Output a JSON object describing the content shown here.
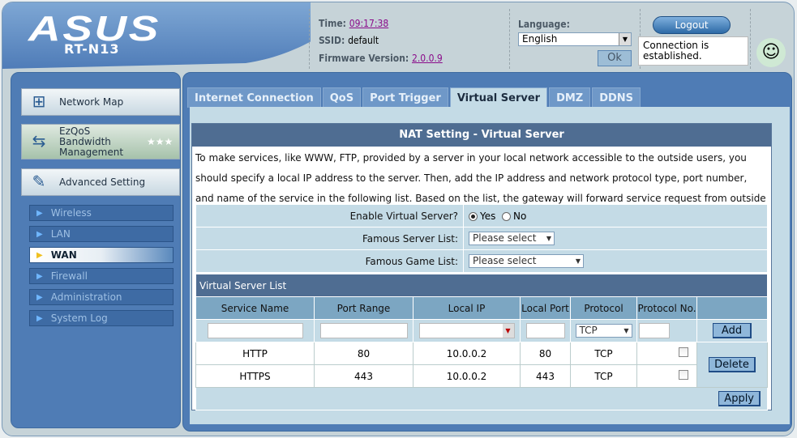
{
  "header": {
    "brand": "ASUS",
    "model": "RT-N13",
    "time_label": "Time:",
    "time": "09:17:38",
    "ssid_label": "SSID:",
    "ssid": "default",
    "firmware_label": "Firmware Version:",
    "firmware": "2.0.0.9",
    "language_label": "Language:",
    "language": "English",
    "ok": "Ok",
    "logout": "Logout",
    "status_tip": "Connection is established."
  },
  "sidebar": {
    "items": [
      {
        "label": "Network Map",
        "icon": "network-icon"
      },
      {
        "label": "EzQoS Bandwidth Management",
        "icon": "bandwidth-icon"
      },
      {
        "label": "Advanced Setting",
        "icon": "wrench-icon"
      }
    ],
    "sub": [
      {
        "label": "Wireless"
      },
      {
        "label": "LAN"
      },
      {
        "label": "WAN",
        "active": true
      },
      {
        "label": "Firewall"
      },
      {
        "label": "Administration"
      },
      {
        "label": "System Log"
      }
    ]
  },
  "tabs": [
    "Internet Connection",
    "QoS",
    "Port Trigger",
    "Virtual Server",
    "DMZ",
    "DDNS"
  ],
  "active_tab": "Virtual Server",
  "page": {
    "title": "NAT Setting - Virtual Server",
    "description": "To make services, like WWW, FTP, provided by a server in your local network accessible to the outside users, you should specify a local IP address to the server. Then, add the IP address and network protocol type, port number, and name of the service in the following list. Based on the list, the gateway will forward service request from outside users to the corresponding local server.",
    "enable_label": "Enable Virtual Server?",
    "yes": "Yes",
    "no": "No",
    "enabled": true,
    "famous_server_label": "Famous Server List:",
    "famous_server_value": "Please select",
    "famous_game_label": "Famous Game List:",
    "famous_game_value": "Please select",
    "list_title": "Virtual Server List",
    "columns": [
      "Service Name",
      "Port Range",
      "Local IP",
      "Local Port",
      "Protocol",
      "Protocol No."
    ],
    "new_protocol": "TCP",
    "add": "Add",
    "delete": "Delete",
    "apply": "Apply",
    "rows": [
      {
        "service": "HTTP",
        "port_range": "80",
        "local_ip": "10.0.0.2",
        "local_port": "80",
        "protocol": "TCP",
        "protocol_no": ""
      },
      {
        "service": "HTTPS",
        "port_range": "443",
        "local_ip": "10.0.0.2",
        "local_port": "443",
        "protocol": "TCP",
        "protocol_no": ""
      }
    ]
  }
}
